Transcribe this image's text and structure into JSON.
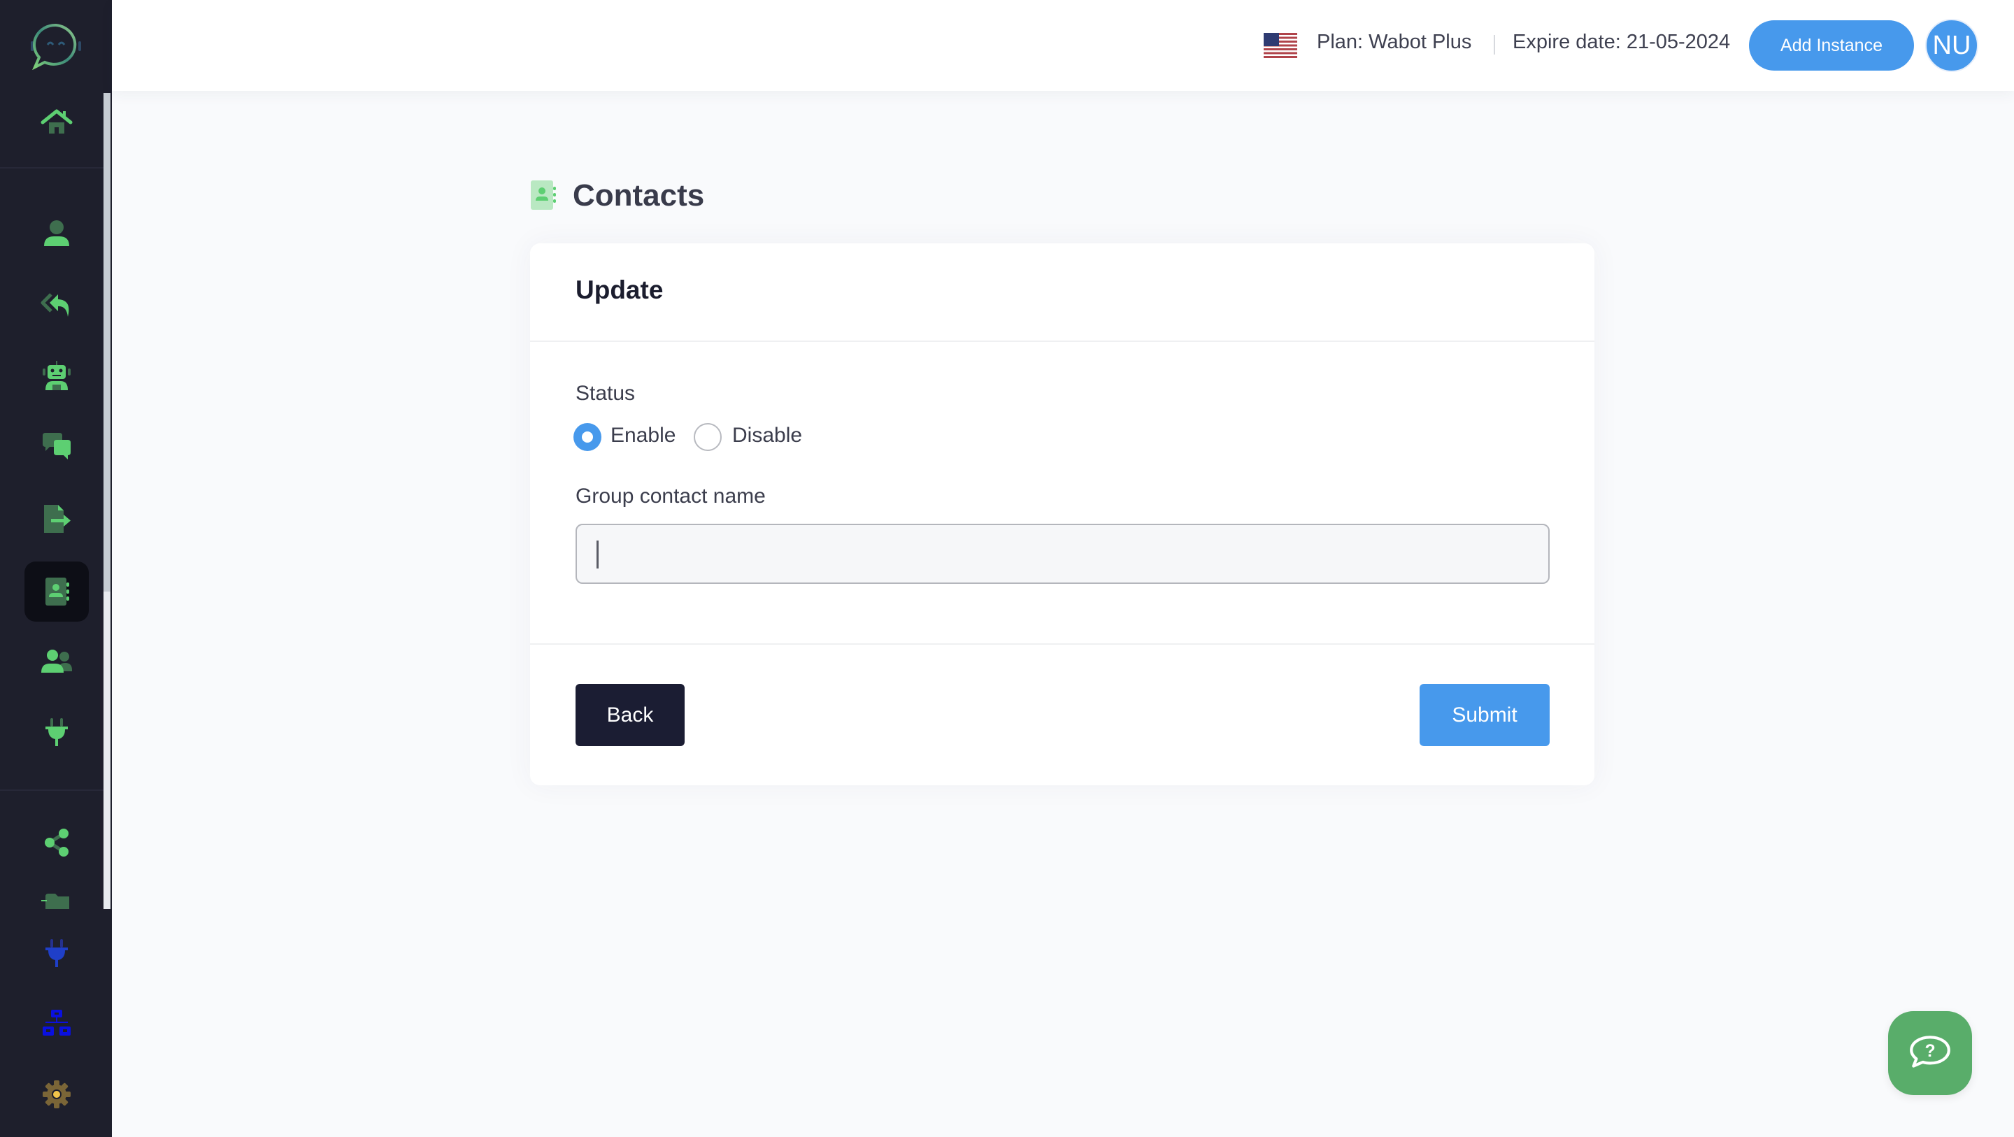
{
  "app": {
    "logo": "chatbot-logo"
  },
  "sidebar": {
    "items": [
      {
        "id": "home",
        "icon": "home-icon"
      },
      {
        "id": "profile",
        "icon": "user-icon"
      },
      {
        "id": "auto-reply",
        "icon": "reply-all-icon"
      },
      {
        "id": "chatbot",
        "icon": "robot-icon"
      },
      {
        "id": "chat",
        "icon": "comments-icon"
      },
      {
        "id": "export",
        "icon": "file-export-icon"
      },
      {
        "id": "contacts",
        "icon": "address-book-icon",
        "active": true
      },
      {
        "id": "users",
        "icon": "users-icon"
      },
      {
        "id": "integrations",
        "icon": "plug-icon"
      },
      {
        "id": "share",
        "icon": "share-nodes-icon"
      },
      {
        "id": "files",
        "icon": "folder-icon"
      }
    ],
    "fixed_items": [
      {
        "id": "plugins",
        "icon": "plug-icon"
      },
      {
        "id": "sitemap",
        "icon": "sitemap-icon"
      },
      {
        "id": "settings",
        "icon": "gear-icon"
      }
    ]
  },
  "header": {
    "language_flag": "us-flag-icon",
    "plan": "Plan: Wabot Plus",
    "expire": "Expire date: 21-05-2024",
    "add_instance_label": "Add Instance",
    "avatar_initials": "NU"
  },
  "page": {
    "title": "Contacts",
    "title_icon": "address-book-icon"
  },
  "form": {
    "card_title": "Update",
    "status_label": "Status",
    "status_options": [
      {
        "label": "Enable",
        "checked": true
      },
      {
        "label": "Disable",
        "checked": false
      }
    ],
    "group_name_label": "Group contact name",
    "group_name_value": "",
    "group_name_placeholder": "",
    "back_label": "Back",
    "submit_label": "Submit"
  },
  "help": {
    "icon": "help-chat-icon"
  },
  "colors": {
    "accent_blue": "#4799ec",
    "sidebar_bg": "#1e1f2c",
    "icon_green": "#5dcf72",
    "icon_green_dark": "#3e6e4e",
    "back_button": "#1b1d33",
    "help_green": "#59ad6a"
  }
}
